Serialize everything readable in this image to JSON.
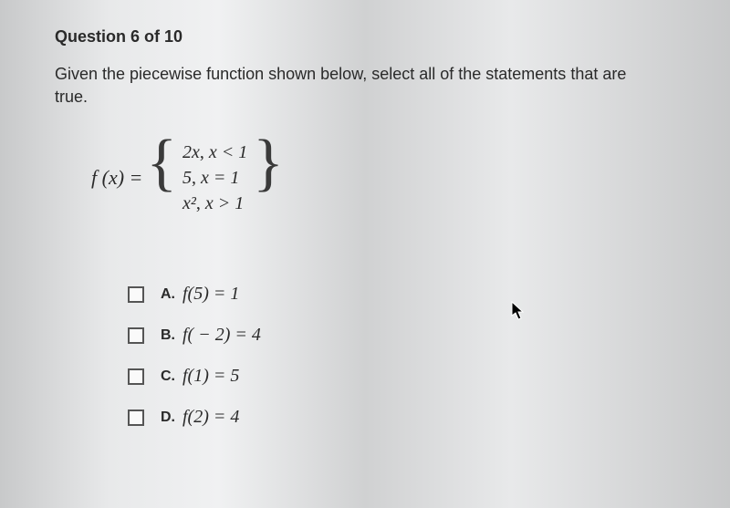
{
  "question": {
    "number": "Question 6 of 10",
    "text": "Given the piecewise function shown below, select all of the statements that are true."
  },
  "piecewise": {
    "label": "f (x) =",
    "cases": [
      {
        "expr": "2x",
        "cond": "x < 1"
      },
      {
        "expr": "5",
        "cond": "x = 1"
      },
      {
        "expr": "x²",
        "cond": "x > 1"
      }
    ]
  },
  "options": [
    {
      "letter": "A.",
      "math": "f(5) = 1"
    },
    {
      "letter": "B.",
      "math": "f( − 2) = 4"
    },
    {
      "letter": "C.",
      "math": "f(1) = 5"
    },
    {
      "letter": "D.",
      "math": "f(2) = 4"
    }
  ]
}
